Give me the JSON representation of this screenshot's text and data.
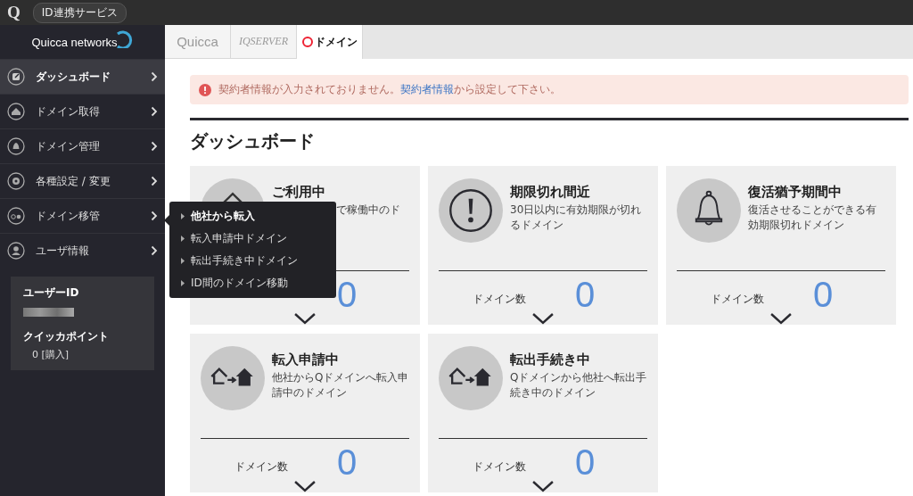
{
  "top_bar": {
    "logo": "Q",
    "service_button": "ID連携サービス"
  },
  "sidebar": {
    "brand": "Quicca networks",
    "items": [
      {
        "label": "ダッシュボード",
        "selected": true
      },
      {
        "label": "ドメイン取得",
        "selected": false
      },
      {
        "label": "ドメイン管理",
        "selected": false
      },
      {
        "label": "各種設定 / 変更",
        "selected": false
      },
      {
        "label": "ドメイン移管",
        "selected": false,
        "submenu": [
          "他社から転入",
          "転入申請中ドメイン",
          "転出手続き中ドメイン",
          "ID間のドメイン移動"
        ]
      },
      {
        "label": "ユーザ情報",
        "selected": false
      }
    ],
    "user_box": {
      "id_label": "ユーザーID",
      "points_label": "クイッカポイント",
      "points_value": "0 [購入]"
    }
  },
  "tabs": [
    {
      "label": "Quicca",
      "kind": "quicca",
      "selected": false
    },
    {
      "label": "IQSERVER",
      "kind": "iq",
      "selected": false
    },
    {
      "label": "ドメイン",
      "kind": "qdomain",
      "selected": true
    }
  ],
  "alert": {
    "before": "契約者情報が入力されておりません。",
    "link": "契約者情報",
    "after": "から設定して下さい。"
  },
  "heading": "ダッシュボード",
  "cards": [
    {
      "title": "ご利用中",
      "description": "で稼働中のド",
      "covered": true,
      "count": "0"
    },
    {
      "title": "期限切れ間近",
      "description": "30日以内に有効期限が切れるドメイン",
      "covered": false,
      "count_label": "ドメイン数",
      "count": "0"
    },
    {
      "title": "復活猶予期間中",
      "description": "復活させることができる有効期限切れドメイン",
      "covered": false,
      "count_label": "ドメイン数",
      "count": "0"
    },
    {
      "title": "転入申請中",
      "description": "他社からQドメインへ転入申請中のドメイン",
      "covered": false,
      "count_label": "ドメイン数",
      "count": "0"
    },
    {
      "title": "転出手続き中",
      "description": "Qドメインから他社へ転出手続き中のドメイン",
      "covered": false,
      "count_label": "ドメイン数",
      "count": "0"
    }
  ]
}
